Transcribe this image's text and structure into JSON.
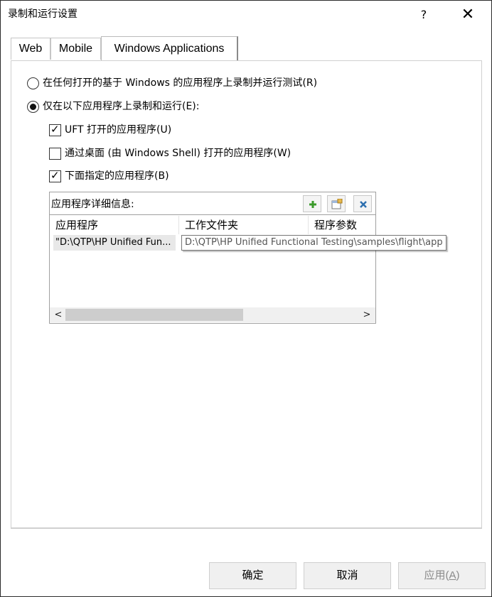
{
  "window": {
    "title": "录制和运行设置",
    "help_label": "?",
    "close_label": "✕"
  },
  "tabs": [
    {
      "label": "Web",
      "selected": false
    },
    {
      "label": "Mobile",
      "selected": false
    },
    {
      "label": "Windows Applications",
      "selected": true
    }
  ],
  "options": {
    "radio_any": {
      "label": "在任何打开的基于 Windows 的应用程序上录制并运行测试(R)",
      "checked": false
    },
    "radio_only": {
      "label": "仅在以下应用程序上录制和运行(E):",
      "checked": true
    },
    "check_uft": {
      "label": "UFT 打开的应用程序(U)",
      "checked": true
    },
    "check_shell": {
      "label": "通过桌面 (由 Windows Shell) 打开的应用程序(W)",
      "checked": false
    },
    "check_specified": {
      "label": "下面指定的应用程序(B)",
      "checked": true
    }
  },
  "details": {
    "label": "应用程序详细信息:",
    "toolbar": [
      "add-icon",
      "edit-icon",
      "delete-icon"
    ],
    "columns": [
      "应用程序",
      "工作文件夹",
      "程序参数"
    ],
    "rows": [
      {
        "app": "\"D:\\QTP\\HP Unified Fun...",
        "folder": "",
        "args": ""
      }
    ],
    "tooltip": "D:\\QTP\\HP Unified Functional Testing\\samples\\flight\\app"
  },
  "scrollbar": {
    "left_arrow": "<",
    "right_arrow": ">"
  },
  "buttons": {
    "ok": "确定",
    "cancel": "取消",
    "apply": "应用(A)",
    "apply_text": "应用(",
    "apply_key": "A",
    "apply_close": ")",
    "apply_enabled": false
  }
}
